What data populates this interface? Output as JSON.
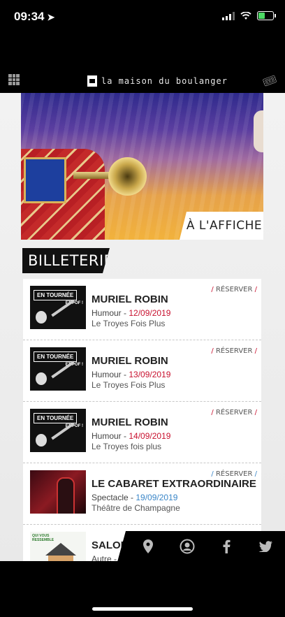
{
  "status_bar": {
    "time": "09:34",
    "location_arrow": "➤"
  },
  "header": {
    "logo_text": "la maison du boulanger"
  },
  "banner": {
    "label": "À L'AFFICHE"
  },
  "section": {
    "title": "BILLETERIE"
  },
  "events": [
    {
      "title": "MURIEL ROBIN",
      "genre": "Humour -",
      "date": "12/09/2019",
      "venue": "Le Troyes Fois Plus",
      "reserve": "RÉSERVER",
      "thumb_tag": "EN TOURNÉE",
      "thumb_sub": "ET POF !"
    },
    {
      "title": "MURIEL ROBIN",
      "genre": "Humour -",
      "date": "13/09/2019",
      "venue": "Le Troyes Fois Plus",
      "reserve": "RÉSERVER",
      "thumb_tag": "EN TOURNÉE",
      "thumb_sub": "ET POF !"
    },
    {
      "title": "MURIEL ROBIN",
      "genre": "Humour -",
      "date": "14/09/2019",
      "venue": "Le Troyes fois plus",
      "reserve": "RÉSERVER",
      "thumb_tag": "EN TOURNÉE",
      "thumb_sub": "ET POF !"
    },
    {
      "title": "LE CABARET EXTRAORDINAIRE",
      "genre": "Spectacle -",
      "date": "19/09/2019",
      "venue": "Théâtre de Champagne",
      "reserve": "RÉSERVER"
    },
    {
      "title": "SALON",
      "genre": "Autre -",
      "thumb_text": "QUI VOUS RESSEMBLE"
    }
  ],
  "colors": {
    "accent_red": "#c8102e",
    "accent_blue": "#3a86c8",
    "header_bg": "#000000"
  },
  "nav_icons": [
    "location-pin-icon",
    "user-circle-icon",
    "facebook-icon",
    "twitter-icon"
  ]
}
